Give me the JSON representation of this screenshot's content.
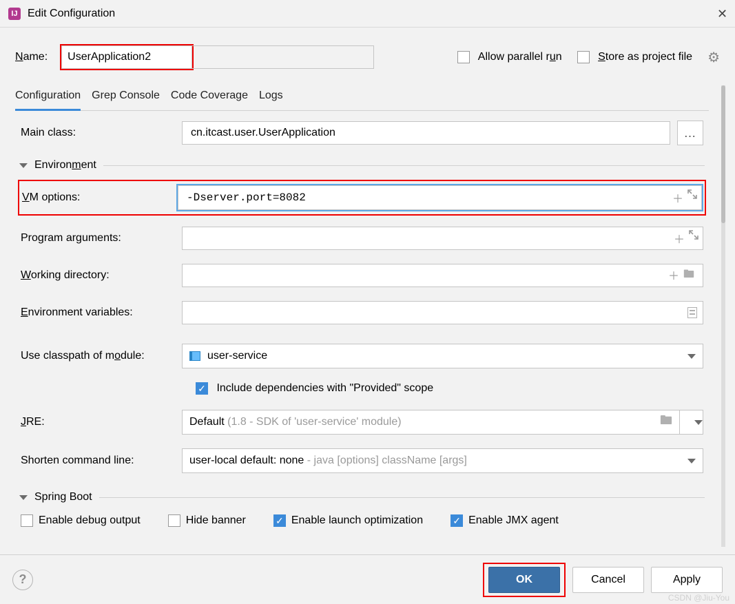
{
  "title": "Edit Configuration",
  "name": {
    "label": "Name:",
    "value": "UserApplication2",
    "underline": "N"
  },
  "options": {
    "allow_parallel": {
      "label": "Allow parallel run",
      "checked": false,
      "underline": "u"
    },
    "store_project": {
      "label": "Store as project file",
      "checked": false,
      "underline": "S"
    }
  },
  "tabs": [
    "Configuration",
    "Grep Console",
    "Code Coverage",
    "Logs"
  ],
  "active_tab": 0,
  "form": {
    "main_class": {
      "label": "Main class:",
      "value": "cn.itcast.user.UserApplication"
    },
    "environment_section": "Environment",
    "vm_options": {
      "label": "VM options:",
      "value": "-Dserver.port=8082",
      "underline": "V"
    },
    "program_args": {
      "label": "Program arguments:",
      "value": "",
      "underline": "g"
    },
    "working_dir": {
      "label": "Working directory:",
      "value": "",
      "underline": "W"
    },
    "env_vars": {
      "label": "Environment variables:",
      "value": "",
      "underline": "E"
    },
    "classpath": {
      "label": "Use classpath of module:",
      "value": "user-service",
      "underline": "o"
    },
    "include_provided": {
      "label": "Include dependencies with \"Provided\" scope",
      "checked": true
    },
    "jre": {
      "label": "JRE:",
      "value": "Default ",
      "hint": "(1.8 - SDK of 'user-service' module)",
      "underline": "J"
    },
    "shorten": {
      "label": "Shorten command line:",
      "value": "user-local default: none ",
      "hint": "- java [options] className [args]"
    },
    "springboot_section": "Spring Boot",
    "sb": {
      "debug": {
        "label": "Enable debug output",
        "checked": false
      },
      "hide": {
        "label": "Hide banner",
        "checked": false
      },
      "launch": {
        "label": "Enable launch optimization",
        "checked": true
      },
      "jmx": {
        "label": "Enable JMX agent",
        "checked": true
      }
    }
  },
  "buttons": {
    "ok": "OK",
    "cancel": "Cancel",
    "apply": "Apply"
  },
  "watermark": "CSDN @Jiu-You"
}
